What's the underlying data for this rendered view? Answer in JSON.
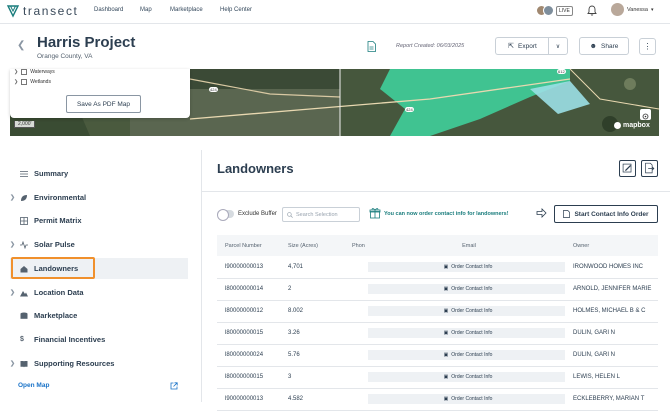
{
  "app": {
    "brand": "transect"
  },
  "nav": {
    "links": [
      "Dashboard",
      "Map",
      "Marketplace",
      "Help Center"
    ],
    "live_label": "LIVE",
    "user_name": "Vanessa"
  },
  "project": {
    "title": "Harris Project",
    "subtitle": "Orange County, VA",
    "report_label": "Report Created:",
    "report_date": "06/03/2025"
  },
  "toolbar": {
    "export_label": "Export",
    "share_label": "Share"
  },
  "map": {
    "layers": [
      {
        "label": "Waterways"
      },
      {
        "label": "Wetlands"
      }
    ],
    "save_pdf_label": "Save As PDF Map",
    "scale_label": "2,000'",
    "attribution": "mapbox",
    "road_signs": [
      "424",
      "424",
      "612"
    ]
  },
  "sidebar": {
    "items": [
      {
        "label": "Summary",
        "icon": "list-icon",
        "expandable": false
      },
      {
        "label": "Environmental",
        "icon": "leaf-icon",
        "expandable": true
      },
      {
        "label": "Permit Matrix",
        "icon": "grid-icon",
        "expandable": false
      },
      {
        "label": "Solar Pulse",
        "icon": "pulse-icon",
        "expandable": true
      },
      {
        "label": "Landowners",
        "icon": "house-icon",
        "expandable": false
      },
      {
        "label": "Location Data",
        "icon": "mountain-icon",
        "expandable": true
      },
      {
        "label": "Marketplace",
        "icon": "database-icon",
        "expandable": false
      },
      {
        "label": "Financial Incentives",
        "icon": "dollar-icon",
        "expandable": false
      },
      {
        "label": "Supporting Resources",
        "icon": "book-icon",
        "expandable": true
      }
    ],
    "active_item": "Landowners",
    "open_map_label": "Open Map"
  },
  "landowners": {
    "title": "Landowners",
    "exclude_buffer_label": "Exclude Buffer",
    "search_placeholder": "Search Selection",
    "promo_text": "You can now order contact info for landowners!",
    "start_order_label": "Start Contact Info Order",
    "columns": [
      "Parcel Number",
      "Size (Acres)",
      "Phone",
      "Email",
      "Owner"
    ],
    "order_contact_label": "Order Contact Info",
    "rows": [
      {
        "parcel": "l90000000013",
        "size": "4,701",
        "owner": "IRONWOOD HOMES INC"
      },
      {
        "parcel": "l80000000014",
        "size": "2",
        "owner": "ARNOLD, JENNIFER MARIE"
      },
      {
        "parcel": "l80000000012",
        "size": "8.002",
        "owner": "HOLMES, MICHAEL B & C"
      },
      {
        "parcel": "l80000000015",
        "size": "3.26",
        "owner": "DULIN, GARI N"
      },
      {
        "parcel": "l80000000024",
        "size": "5.76",
        "owner": "DULIN, GARI N"
      },
      {
        "parcel": "l80000000015",
        "size": "3",
        "owner": "LEWIS, HELEN L"
      },
      {
        "parcel": "l90000000013",
        "size": "4.582",
        "owner": "ECKLEBERRY, MARIAN T"
      }
    ]
  },
  "colors": {
    "accent": "#f0902c",
    "teal": "#1a7d7d",
    "navy": "#2c3e50",
    "map_green": "#3fd6a0"
  }
}
